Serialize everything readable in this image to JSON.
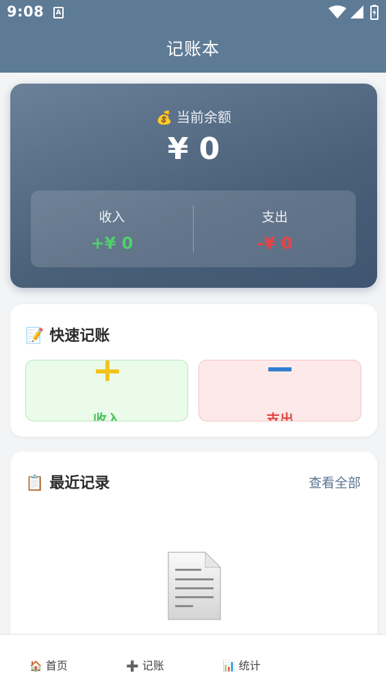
{
  "status": {
    "time": "9:08",
    "notif_letter": "A"
  },
  "header": {
    "title": "记账本"
  },
  "balance": {
    "label_emoji": "💰",
    "label": "当前余额",
    "amount": "¥ 0",
    "income_label": "收入",
    "income_value": "+¥ 0",
    "expense_label": "支出",
    "expense_value": "-¥ 0"
  },
  "quick": {
    "title_emoji": "📝",
    "title": "快速记账",
    "income_label": "收入",
    "expense_label": "支出"
  },
  "recent": {
    "title_emoji": "📋",
    "title": "最近记录",
    "view_all": "查看全部"
  },
  "nav": {
    "items": [
      {
        "emoji": "🏠",
        "label": "首页"
      },
      {
        "emoji": "➕",
        "label": "记账"
      },
      {
        "emoji": "📊",
        "label": "统计"
      }
    ]
  },
  "colors": {
    "header": "#5e7b96",
    "income": "#4fd16b",
    "expense": "#e84444",
    "link": "#5a7591"
  }
}
